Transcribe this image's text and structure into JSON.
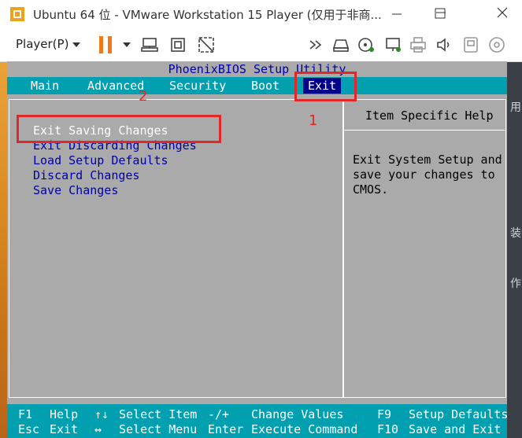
{
  "window": {
    "title": "Ubuntu 64 位 - VMware Workstation 15 Player (仅用于非商..."
  },
  "toolbar": {
    "player_label": "Player(P)",
    "icons": [
      "pause-icon",
      "send-keys-icon",
      "fit-icon",
      "unity-icon",
      "forward-icon",
      "hdd-icon",
      "cd-icon",
      "network-icon",
      "printer-icon",
      "sound-icon",
      "usb-icon",
      "disc-icon"
    ]
  },
  "bios": {
    "title": "PhoenixBIOS Setup Utility",
    "menu": [
      {
        "label": "Main"
      },
      {
        "label": "Advanced"
      },
      {
        "label": "Security"
      },
      {
        "label": "Boot"
      },
      {
        "label": "Exit"
      }
    ],
    "options": [
      {
        "label": "Exit Saving Changes"
      },
      {
        "label": "Exit Discarding Changes"
      },
      {
        "label": "Load Setup Defaults"
      },
      {
        "label": "Discard Changes"
      },
      {
        "label": "Save Changes"
      }
    ],
    "help_title": "Item Specific Help",
    "help_lines": [
      "Exit System Setup and",
      "save your changes to",
      "CMOS."
    ],
    "footer": {
      "row1": {
        "k1": "F1",
        "d1": "Help",
        "k2": "↑↓",
        "d2": "Select Item",
        "k3": "-/+",
        "d3": "Change Values",
        "k4": "F9",
        "d4": "Setup Defaults"
      },
      "row2": {
        "k1": "Esc",
        "d1": "Exit",
        "k2": "↔",
        "d2": "Select Menu",
        "k3": "Enter",
        "d3": "Execute Command",
        "k4": "F10",
        "d4": "Save and Exit"
      }
    }
  },
  "annotations": {
    "num1": "1",
    "num2": "2"
  },
  "background": {
    "right_chars": [
      "用",
      "装",
      "作"
    ]
  },
  "colors": {
    "bios_bg": "#aaaaaa",
    "bios_bar": "#00a0b0",
    "bios_option": "#0000aa",
    "bios_active_tab": "#00008a",
    "annotation_red": "#e02828",
    "pause_orange": "#f07a1a"
  }
}
